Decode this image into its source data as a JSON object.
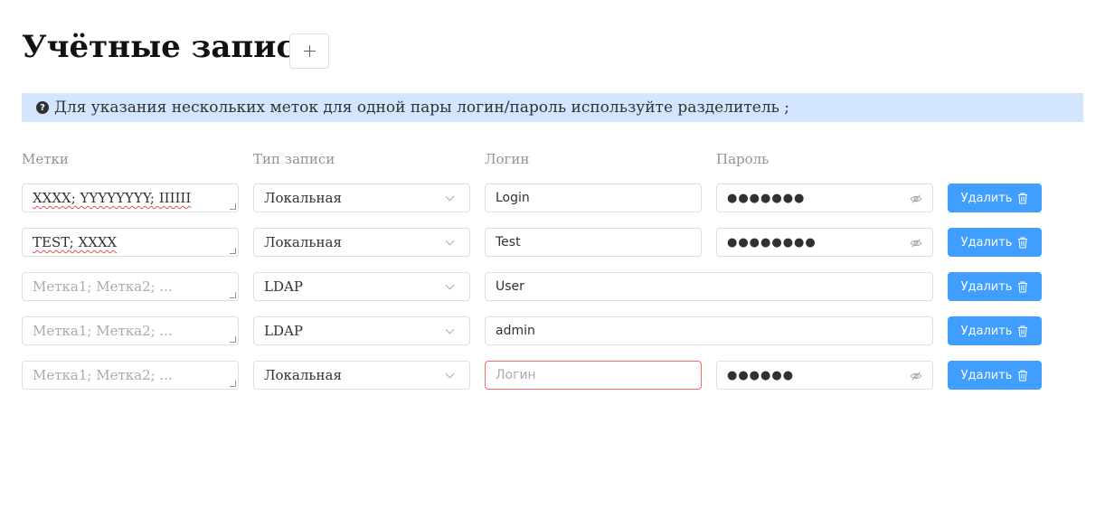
{
  "page": {
    "title": "Учётные записи",
    "add_button_icon": "plus-icon"
  },
  "info": {
    "icon": "question-circle-icon",
    "icon_glyph": "?",
    "text": "Для указания нескольких меток для одной пары логин/пароль используйте разделитель ;"
  },
  "columns": {
    "tags": "Метки",
    "type": "Тип записи",
    "login": "Логин",
    "password": "Пароль"
  },
  "placeholders": {
    "tags": "Метка1; Метка2; ...",
    "login": "Логин"
  },
  "rows": [
    {
      "tags": "XXXX; YYYYYYYY; IIIIII",
      "type": "Локальная",
      "login": "Login",
      "password": "●●●●●●●",
      "delete": "Удалить"
    },
    {
      "tags": "TEST; XXXX",
      "type": "Локальная",
      "login": "Test",
      "password": "●●●●●●●●",
      "delete": "Удалить"
    },
    {
      "tags": "",
      "type": "LDAP",
      "login": "User",
      "delete": "Удалить"
    },
    {
      "tags": "",
      "type": "LDAP",
      "login": "admin",
      "delete": "Удалить"
    },
    {
      "tags": "",
      "type": "Локальная",
      "login": "",
      "password": "●●●●●●",
      "delete": "Удалить",
      "login_invalid": true
    }
  ],
  "colors": {
    "info_bg": "#d4e6ff",
    "primary": "#409eff",
    "error_border": "#f56c6c"
  }
}
